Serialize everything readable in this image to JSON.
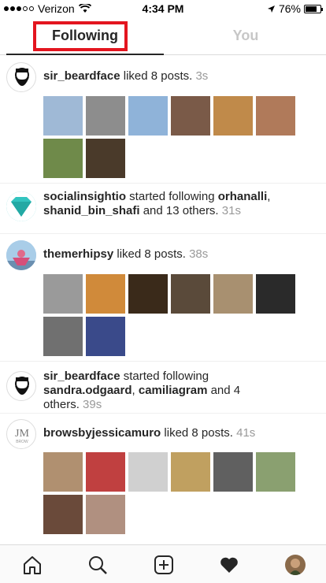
{
  "status_bar": {
    "carrier": "Verizon",
    "time": "4:34 PM",
    "battery": "76%",
    "battery_level": 0.76
  },
  "tabs": {
    "following": "Following",
    "you": "You"
  },
  "notifications": [
    {
      "user": "sir_beardface",
      "action": " liked 8 posts. ",
      "time": "3s",
      "thumbs": [
        "#9fb9d6",
        "#8d8d8d",
        "#8fb3d9",
        "#7a5a48",
        "#c08a4a",
        "#b07a5a",
        "#6f8a4a",
        "#4a3a2a"
      ]
    },
    {
      "user": "socialinsightio",
      "action": " started following ",
      "target1": "orhanalli",
      "sep": ",",
      "target2": "shanid_bin_shafi",
      "rest": " and 13 others. ",
      "time": "31s"
    },
    {
      "user": "themerhipsy",
      "action": " liked 8 posts. ",
      "time": "38s",
      "thumbs": [
        "#9a9a9a",
        "#d08a3a",
        "#3a2a1a",
        "#5a4a3a",
        "#a89070",
        "#2a2a2a",
        "#707070",
        "#3a4a8a"
      ]
    },
    {
      "user": "sir_beardface",
      "action": " started following",
      "target1": "sandra.odgaard",
      "sep": ",",
      "target2": "camiliagram",
      "rest": " and 4",
      "rest2": "others. ",
      "time": "39s"
    },
    {
      "user": "browsbyjessicamuro",
      "action": " liked 8 posts. ",
      "time": "41s",
      "thumbs": [
        "#b09070",
        "#c04040",
        "#d0d0d0",
        "#c0a060",
        "#606060",
        "#8aa070",
        "#6a4a3a",
        "#b09080"
      ]
    }
  ],
  "nav": {
    "home": "home-icon",
    "search": "search-icon",
    "add": "add-icon",
    "activity": "heart-icon",
    "profile": "profile-avatar"
  }
}
